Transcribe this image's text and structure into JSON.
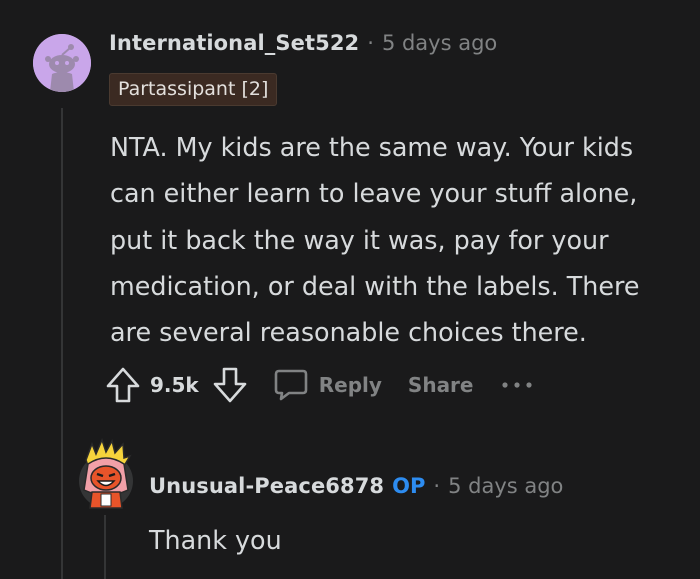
{
  "comment": {
    "username": "International_Set522",
    "separator": "·",
    "timestamp": "5 days ago",
    "flair": "Partassipant [2]",
    "body": "NTA. My kids are the same way. Your kids can either learn to leave your stuff alone, put it back the way it was, pay for your medication, or deal with the labels. There are several reasonable choices there.",
    "vote_count": "9.5k",
    "reply_label": "Reply",
    "share_label": "Share",
    "more_label": "•••"
  },
  "reply": {
    "username": "Unusual-Peace6878",
    "op_badge": "OP",
    "separator": "·",
    "timestamp": "5 days ago",
    "body": "Thank you"
  },
  "colors": {
    "background": "#1a1a1b",
    "text": "#d7dadc",
    "muted": "#818384",
    "op": "#2d8cf0",
    "flair_bg": "#3b2a22",
    "avatar_bg": "#c9a6ea"
  }
}
